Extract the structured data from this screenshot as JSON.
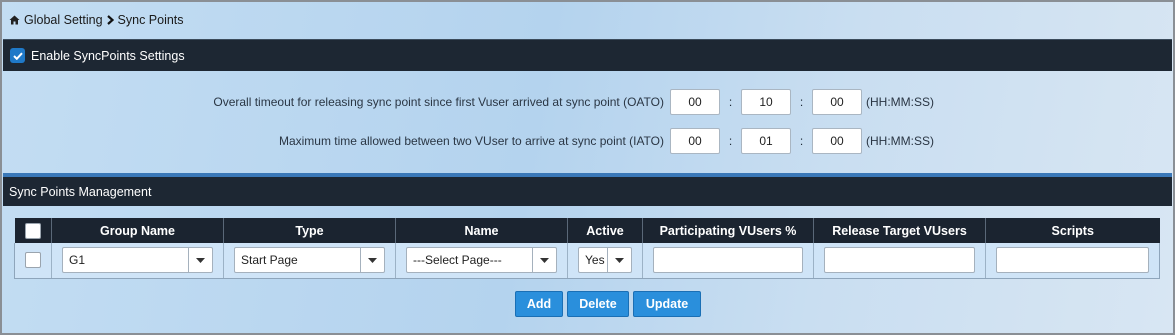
{
  "breadcrumb": {
    "root": "Global Setting",
    "current": "Sync Points"
  },
  "settings_bar": {
    "label": "Enable SyncPoints Settings",
    "checked": true
  },
  "timeouts": [
    {
      "label": "Overall timeout for releasing sync point since first Vuser arrived at sync point (OATO)",
      "hh": "00",
      "mm": "10",
      "ss": "00",
      "format": "(HH:MM:SS)"
    },
    {
      "label": "Maximum time allowed between two VUser to arrive at sync point (IATO)",
      "hh": "00",
      "mm": "01",
      "ss": "00",
      "format": "(HH:MM:SS)"
    }
  ],
  "colon": ":",
  "management": {
    "title": "Sync Points Management"
  },
  "table": {
    "headers": [
      "Group Name",
      "Type",
      "Name",
      "Active",
      "Participating VUsers %",
      "Release Target VUsers",
      "Scripts"
    ],
    "row": {
      "group": "G1",
      "type": "Start Page",
      "name": "---Select Page---",
      "active": "Yes",
      "participating": "",
      "release_target": "",
      "scripts": ""
    }
  },
  "buttons": {
    "add": "Add",
    "delete": "Delete",
    "update": "Update"
  },
  "colors": {
    "header_bar": "#1d2733",
    "accent": "#2a8fdc",
    "row_bg": "#cfe4f7"
  }
}
